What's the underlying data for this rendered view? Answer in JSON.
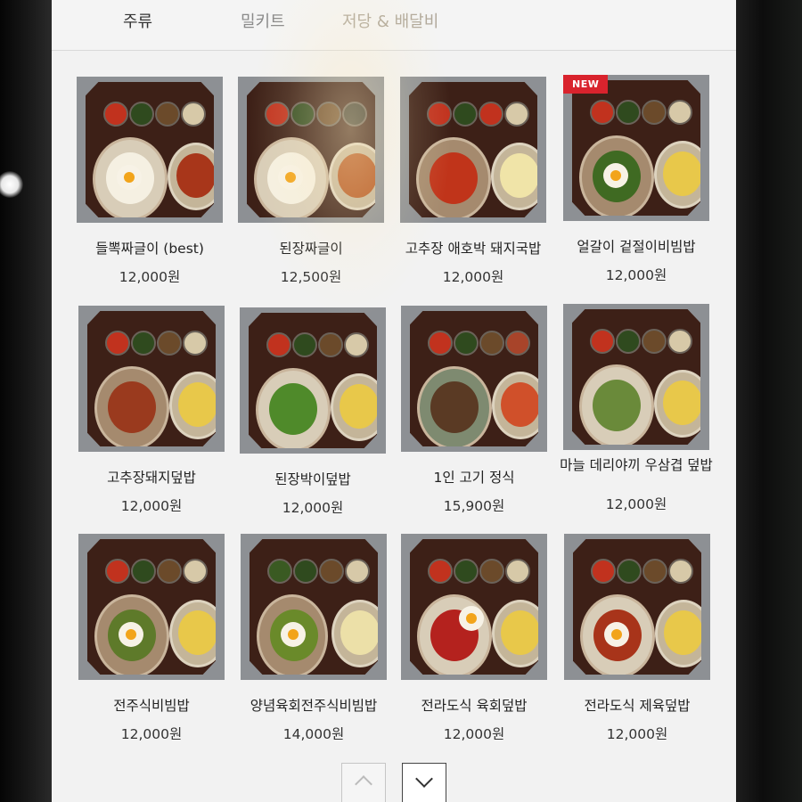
{
  "tabs": [
    {
      "label": "주류"
    },
    {
      "label": "밀키트"
    },
    {
      "label": "저당 & 배달비"
    }
  ],
  "menu": [
    {
      "name": "들뽁짜글이 (best)",
      "price": "12,000원"
    },
    {
      "name": "된장짜글이",
      "price": "12,500원"
    },
    {
      "name": "고추장 애호박 돼지국밥",
      "price": "12,000원"
    },
    {
      "name": "얼갈이 겉절이비빔밥",
      "price": "12,000원",
      "badge": "NEW"
    },
    {
      "name": "고추장돼지덮밥",
      "price": "12,000원"
    },
    {
      "name": "된장박이덮밥",
      "price": "12,000원"
    },
    {
      "name": "1인 고기 정식",
      "price": "15,900원"
    },
    {
      "name": "마늘 데리야끼 우삼겹 덮밥",
      "price": "12,000원"
    },
    {
      "name": "전주식비빔밥",
      "price": "12,000원"
    },
    {
      "name": "양념육회전주식비빔밥",
      "price": "14,000원"
    },
    {
      "name": "전라도식 육회덮밥",
      "price": "12,000원"
    },
    {
      "name": "전라도식 제육덮밥",
      "price": "12,000원"
    }
  ],
  "pager": {
    "up_icon": "chevron-up-icon",
    "down_icon": "chevron-down-icon"
  }
}
